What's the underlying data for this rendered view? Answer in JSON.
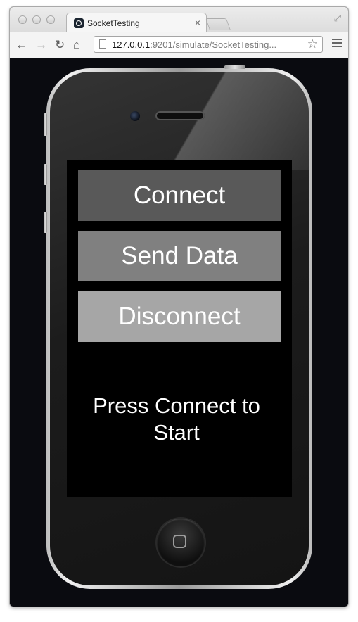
{
  "browser": {
    "tab": {
      "title": "SocketTesting",
      "close_glyph": "×",
      "favicon": "socket-logo-icon"
    },
    "url": {
      "host": "127.0.0.1",
      "rest": ":9201/simulate/SocketTesting..."
    },
    "icons": {
      "back": "←",
      "forward": "→",
      "reload": "↻",
      "home": "⌂",
      "star": "☆",
      "fullscreen": "⤢"
    }
  },
  "app": {
    "buttons": {
      "connect": "Connect",
      "send_data": "Send Data",
      "disconnect": "Disconnect"
    },
    "status_text": "Press Connect to Start"
  },
  "colors": {
    "connect_button": "#595959",
    "send_button": "#808080",
    "disconnect_button": "#a6a6a6",
    "screen": "#000000",
    "page_background": "#0a0b10"
  }
}
